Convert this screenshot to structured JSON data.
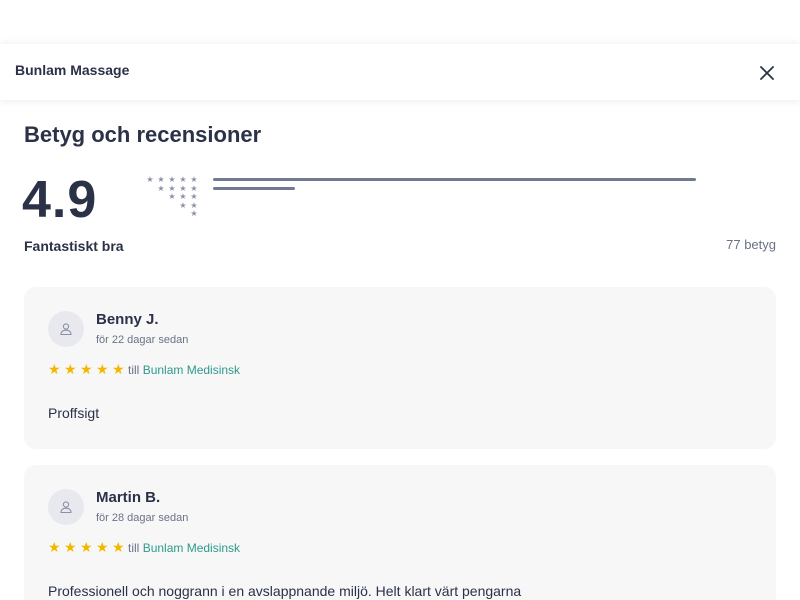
{
  "header": {
    "title": "Bunlam Massage",
    "close_icon": "close-icon"
  },
  "ratings": {
    "section_title": "Betyg och recensioner",
    "score": "4.9",
    "score_label": "Fantastiskt bra",
    "total": "77 betyg",
    "breakdown": [
      {
        "stars": 5,
        "fraction": 1.0
      },
      {
        "stars": 4,
        "fraction": 0.17
      },
      {
        "stars": 3,
        "fraction": 0.0
      },
      {
        "stars": 2,
        "fraction": 0.0
      },
      {
        "stars": 1,
        "fraction": 0.0
      }
    ],
    "bar_color": "#727a92"
  },
  "reviews": [
    {
      "name": "Benny J.",
      "date": "för 22 dagar sedan",
      "rating": 5,
      "till_prefix": "till",
      "business": "Bunlam Medisinsk",
      "text": "Proffsigt"
    },
    {
      "name": "Martin B.",
      "date": "för 28 dagar sedan",
      "rating": 5,
      "till_prefix": "till",
      "business": "Bunlam Medisinsk",
      "text": "Professionell och noggrann i en avslappnande miljö. Helt klart värt pengarna"
    }
  ],
  "colors": {
    "star": "#f7b500",
    "link": "#2e9a8a",
    "text": "#2b3147",
    "card_bg": "#f7f7f8"
  }
}
